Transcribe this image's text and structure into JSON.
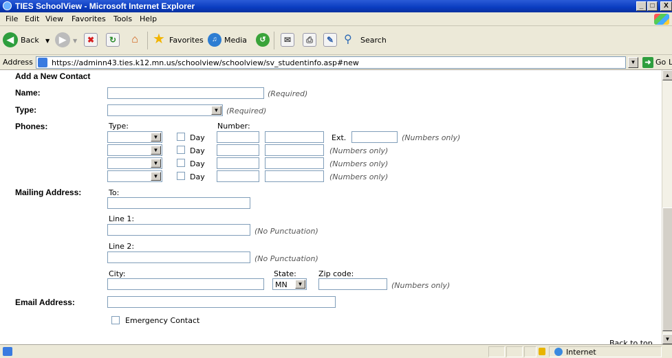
{
  "window": {
    "title": "TIES SchoolView - Microsoft Internet Explorer",
    "minimize": "_",
    "maximize": "□",
    "close": "X"
  },
  "menu": [
    "File",
    "Edit",
    "View",
    "Favorites",
    "Tools",
    "Help"
  ],
  "toolbar": {
    "back_label": "Back",
    "favorites_label": "Favorites",
    "media_label": "Media",
    "search_label": "Search"
  },
  "address": {
    "label": "Address",
    "url": "https://adminn43.ties.k12.mn.us/schoolview/schoolview/sv_studentinfo.asp#new",
    "go_label": "Go",
    "links_label": "Links"
  },
  "form": {
    "heading": "Add a New Contact",
    "name_label": "Name:",
    "name_value": "",
    "required_hint": "(Required)",
    "type_label": "Type:",
    "type_value": "",
    "type_required_hint": "(Required)",
    "phones_label": "Phones:",
    "phone_type_header": "Type:",
    "phone_number_header": "Number:",
    "day_label": "Day",
    "ext_label": "Ext.",
    "numbers_only_hint": "(Numbers only)",
    "phone_rows": [
      {
        "type": "",
        "area": "",
        "number": "",
        "day": false
      },
      {
        "type": "",
        "area": "",
        "number": "",
        "day": false
      },
      {
        "type": "",
        "area": "",
        "number": "",
        "day": false
      },
      {
        "type": "",
        "area": "",
        "number": "",
        "day": false
      }
    ],
    "mailing_label": "Mailing Address:",
    "to_label": "To:",
    "line1_label": "Line 1:",
    "line2_label": "Line 2:",
    "no_punct_hint": "(No Punctuation)",
    "city_label": "City:",
    "state_label": "State:",
    "state_value": "MN",
    "zip_label": "Zip code:",
    "zip_hint": "(Numbers only)",
    "email_label": "Email Address:",
    "emergency_label": "Emergency Contact",
    "back_to_top": "Back to top"
  },
  "status": {
    "zone": "Internet"
  },
  "colors": {
    "titlebar": "#0a3cc0",
    "chrome": "#ece9d8",
    "field_border": "#7f9db9"
  }
}
